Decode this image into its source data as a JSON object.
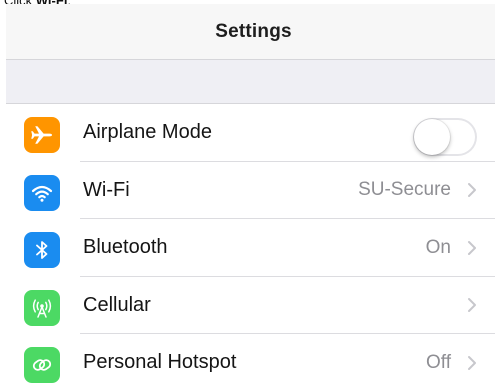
{
  "instruction": {
    "prefix": "Click ",
    "target": "Wi-Fi",
    "suffix": "."
  },
  "navbar": {
    "title": "Settings"
  },
  "colors": {
    "airplane": "#ff9500",
    "wifi": "#1a8cf0",
    "bluetooth": "#1a8cf0",
    "cellular": "#4cd964",
    "hotspot": "#4cd964"
  },
  "rows": [
    {
      "label": "Airplane Mode",
      "icon": "airplane-icon",
      "control": "toggle",
      "toggle_on": false
    },
    {
      "label": "Wi-Fi",
      "icon": "wifi-icon",
      "value": "SU-Secure"
    },
    {
      "label": "Bluetooth",
      "icon": "bluetooth-icon",
      "value": "On"
    },
    {
      "label": "Cellular",
      "icon": "cellular-icon",
      "value": ""
    },
    {
      "label": "Personal Hotspot",
      "icon": "hotspot-icon",
      "value": "Off"
    }
  ]
}
